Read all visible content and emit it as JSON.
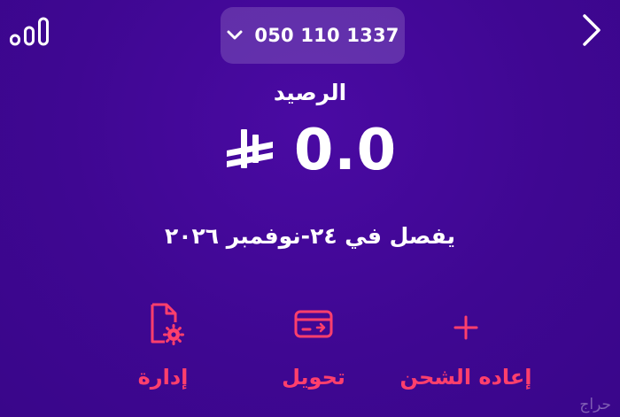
{
  "header": {
    "logo_icon": "bars-logo-icon",
    "phone_number": "050 110 1337",
    "dropdown_icon": "chevron-down-icon",
    "back_icon": "chevron-right-icon"
  },
  "balance": {
    "label": "الرصيد",
    "amount": "0.0",
    "currency_icon": "saudi-riyal-icon",
    "expiry_text": "يفصل في ٢٤-نوفمبر ٢٠٢٦"
  },
  "actions": [
    {
      "label": "إدارة",
      "icon": "document-gear-icon"
    },
    {
      "label": "تحويل",
      "icon": "card-transfer-icon"
    },
    {
      "label": "إعاده الشحن",
      "icon": "plus-icon"
    }
  ],
  "colors": {
    "background": "#3f0792",
    "accent": "#ff3f6c",
    "text": "#ffffff"
  },
  "watermark": "حراج"
}
